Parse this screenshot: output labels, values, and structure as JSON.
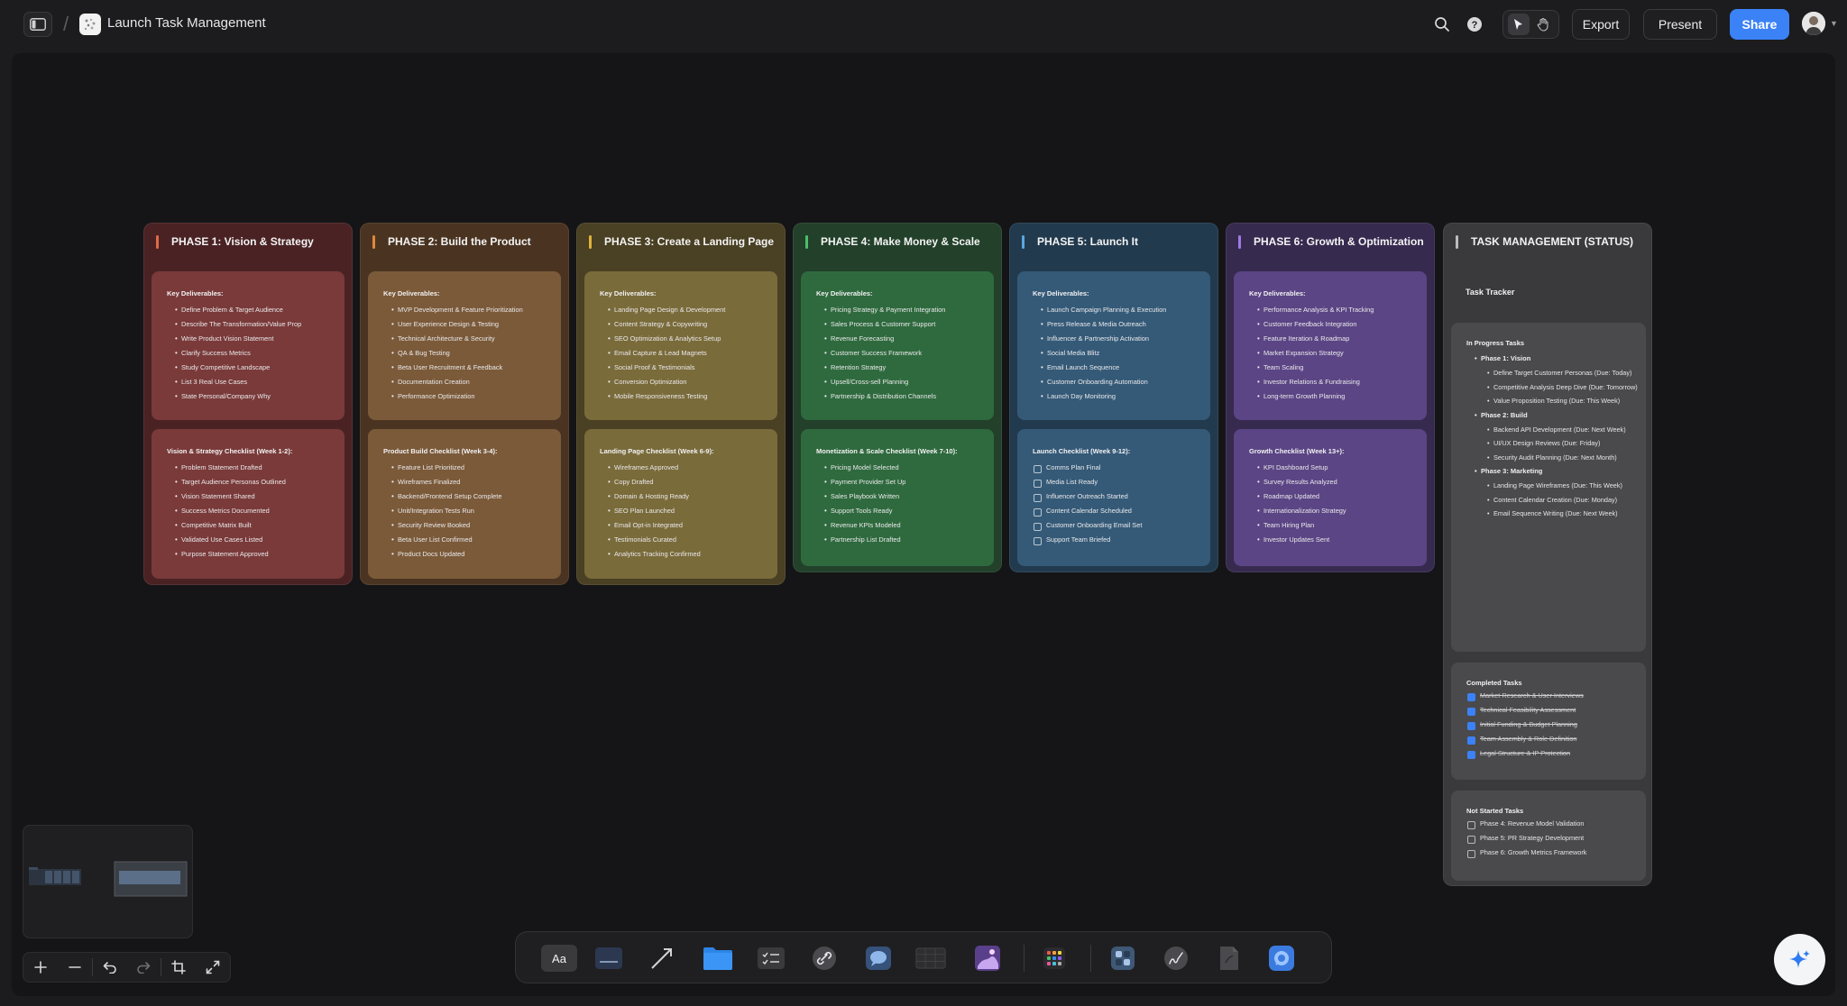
{
  "header": {
    "board_title": "Launch Task Management",
    "breadcrumb_sep": "/",
    "export_label": "Export",
    "present_label": "Present",
    "share_label": "Share"
  },
  "colors": {
    "accent": "#3b82f6",
    "phase1": "#4a2224",
    "phase2": "#4a3421",
    "phase3": "#4a4023",
    "phase4": "#22402a",
    "phase5": "#223a4e",
    "phase6": "#372a4f"
  },
  "phases": [
    {
      "title": "PHASE 1: Vision & Strategy",
      "deliverables_title": "Key Deliverables:",
      "deliverables": [
        "Define Problem & Target Audience",
        "Describe The Transformation/Value Prop",
        "Write Product Vision Statement",
        "Clarify Success Metrics",
        "Study Competitive Landscape",
        "List 3 Real Use Cases",
        "State Personal/Company Why"
      ],
      "checklist_title": "Vision & Strategy Checklist (Week 1-2):",
      "checklist": [
        "Problem Statement Drafted",
        "Target Audience Personas Outlined",
        "Vision Statement Shared",
        "Success Metrics Documented",
        "Competitive Matrix Built",
        "Validated Use Cases Listed",
        "Purpose Statement Approved"
      ]
    },
    {
      "title": "PHASE 2: Build the Product",
      "deliverables_title": "Key Deliverables:",
      "deliverables": [
        "MVP Development & Feature Prioritization",
        "User Experience Design & Testing",
        "Technical Architecture & Security",
        "QA & Bug Testing",
        "Beta User Recruitment & Feedback",
        "Documentation Creation",
        "Performance Optimization"
      ],
      "checklist_title": "Product Build Checklist (Week 3-4):",
      "checklist": [
        "Feature List Prioritized",
        "Wireframes Finalized",
        "Backend/Frontend Setup Complete",
        "Unit/Integration Tests Run",
        "Security Review Booked",
        "Beta User List Confirmed",
        "Product Docs Updated"
      ]
    },
    {
      "title": "PHASE 3: Create a Landing Page",
      "deliverables_title": "Key Deliverables:",
      "deliverables": [
        "Landing Page Design & Development",
        "Content Strategy & Copywriting",
        "SEO Optimization & Analytics Setup",
        "Email Capture & Lead Magnets",
        "Social Proof & Testimonials",
        "Conversion Optimization",
        "Mobile Responsiveness Testing"
      ],
      "checklist_title": "Landing Page Checklist (Week 6-9):",
      "checklist": [
        "Wireframes Approved",
        "Copy Drafted",
        "Domain & Hosting Ready",
        "SEO Plan Launched",
        "Email Opt-in Integrated",
        "Testimonials Curated",
        "Analytics Tracking Confirmed"
      ]
    },
    {
      "title": "PHASE 4: Make Money & Scale",
      "deliverables_title": "Key Deliverables:",
      "deliverables": [
        "Pricing Strategy & Payment Integration",
        "Sales Process & Customer Support",
        "Revenue Forecasting",
        "Customer Success Framework",
        "Retention Strategy",
        "Upsell/Cross-sell Planning",
        "Partnership & Distribution Channels"
      ],
      "checklist_title": "Monetization & Scale Checklist (Week 7-10):",
      "checklist": [
        "Pricing Model Selected",
        "Payment Provider Set Up",
        "Sales Playbook Written",
        "Support Tools Ready",
        "Revenue KPIs Modeled",
        "Partnership List Drafted"
      ]
    },
    {
      "title": "PHASE 5: Launch It",
      "deliverables_title": "Key Deliverables:",
      "deliverables": [
        "Launch Campaign Planning & Execution",
        "Press Release & Media Outreach",
        "Influencer & Partnership Activation",
        "Social Media Blitz",
        "Email Launch Sequence",
        "Customer Onboarding Automation",
        "Launch Day Monitoring"
      ],
      "checklist_title": "Launch Checklist (Week 9-12):",
      "checklist": [
        "Comms Plan Final",
        "Media List Ready",
        "Influencer Outreach Started",
        "Content Calendar Scheduled",
        "Customer Onboarding Email Set",
        "Support Team Briefed"
      ]
    },
    {
      "title": "PHASE 6: Growth & Optimization",
      "deliverables_title": "Key Deliverables:",
      "deliverables": [
        "Performance Analysis & KPI Tracking",
        "Customer Feedback Integration",
        "Feature Iteration & Roadmap",
        "Market Expansion Strategy",
        "Team Scaling",
        "Investor Relations & Fundraising",
        "Long-term Growth Planning"
      ],
      "checklist_title": "Growth Checklist (Week 13+):",
      "checklist": [
        "KPI Dashboard Setup",
        "Survey Results Analyzed",
        "Roadmap Updated",
        "Internationalization Strategy",
        "Team Hiring Plan",
        "Investor Updates Sent"
      ]
    }
  ],
  "task_management": {
    "title": "TASK MANAGEMENT (STATUS)",
    "tracker_label": "Task Tracker",
    "in_progress_title": "In Progress Tasks",
    "in_progress": [
      {
        "phase": "Phase 1: Vision",
        "tasks": [
          "Define Target Customer Personas (Due: Today)",
          "Competitive Analysis Deep Dive (Due: Tomorrow)",
          "Value Proposition Testing (Due: This Week)"
        ]
      },
      {
        "phase": "Phase 2: Build",
        "tasks": [
          "Backend API Development (Due: Next Week)",
          "UI/UX Design Reviews (Due: Friday)",
          "Security Audit Planning (Due: Next Month)"
        ]
      },
      {
        "phase": "Phase 3: Marketing",
        "tasks": [
          "Landing Page Wireframes (Due: This Week)",
          "Content Calendar Creation (Due: Monday)",
          "Email Sequence Writing (Due: Next Week)"
        ]
      }
    ],
    "completed_title": "Completed Tasks",
    "completed": [
      "Market Research & User Interviews",
      "Technical Feasibility Assessment",
      "Initial Funding & Budget Planning",
      "Team Assembly & Role Definition",
      "Legal Structure & IP Protection"
    ],
    "not_started_title": "Not Started Tasks",
    "not_started": [
      "Phase 4: Revenue Model Validation",
      "Phase 5: PR Strategy Development",
      "Phase 6: Growth Metrics Framework"
    ]
  },
  "dock": {
    "text_tool_label": "Aa",
    "items": [
      "text-tool",
      "sticky-note-tool",
      "line-arrow-tool",
      "folder-tool",
      "checklist-tool",
      "link-tool",
      "comment-tool",
      "table-tool",
      "image-tool",
      "apps-tool",
      "widget-tool",
      "draw-tool",
      "document-tool",
      "ai-assistant-tool"
    ]
  }
}
